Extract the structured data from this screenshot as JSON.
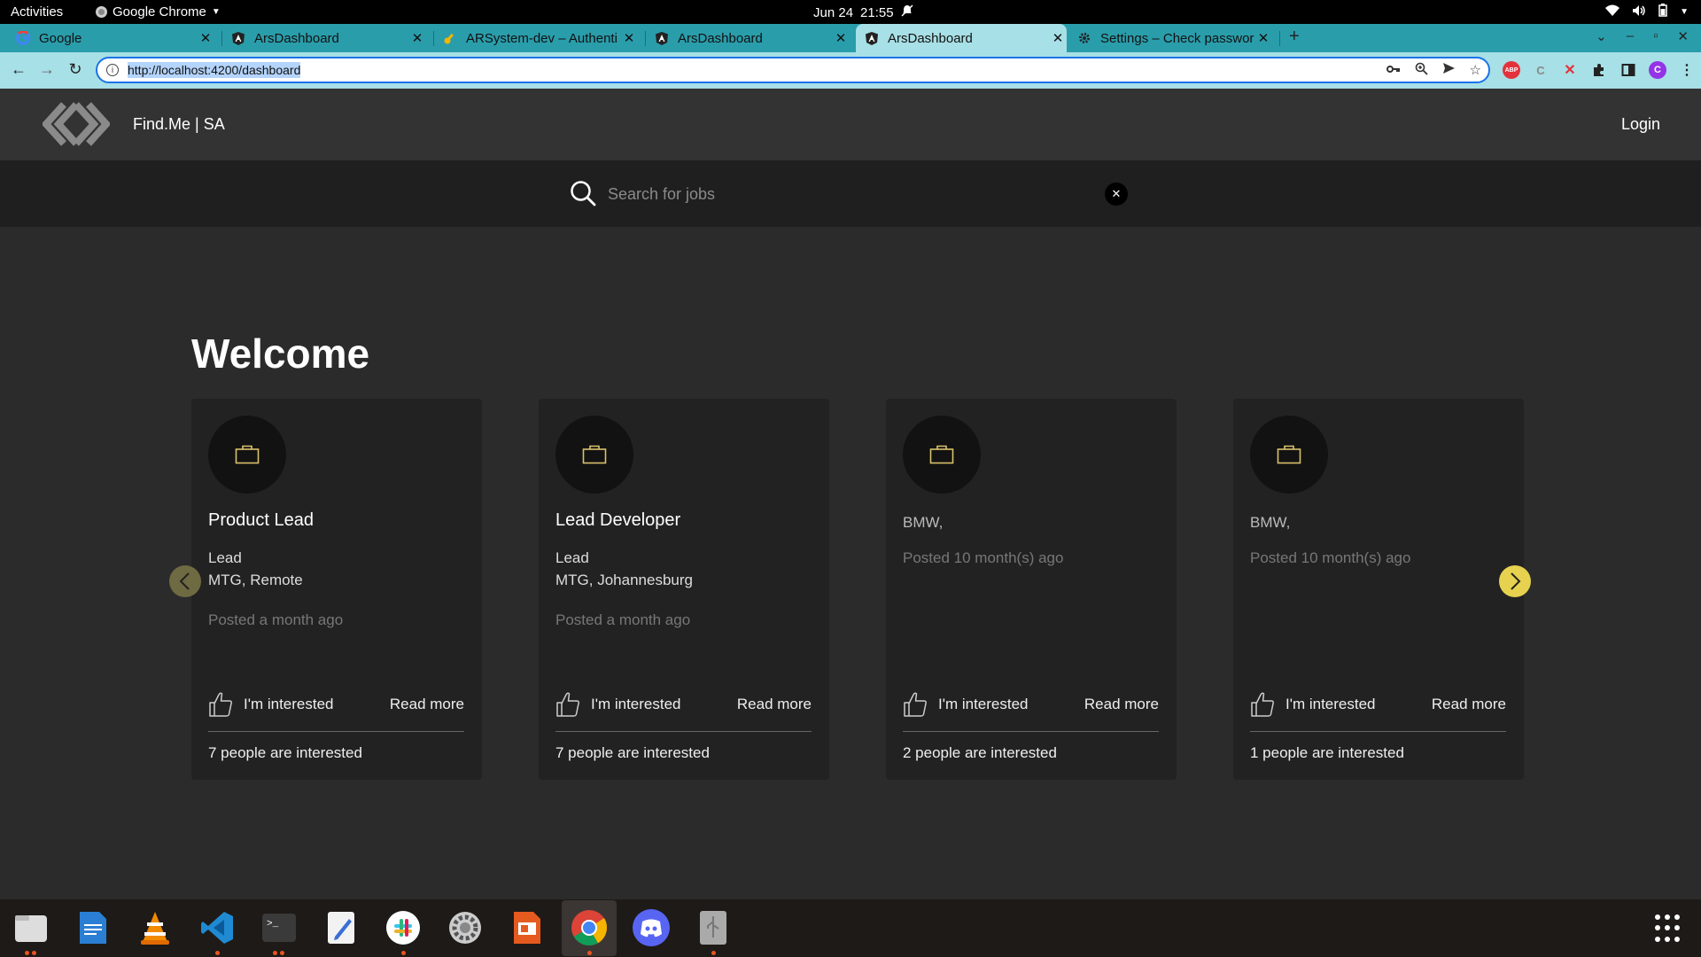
{
  "system": {
    "activities": "Activities",
    "app_name": "Google Chrome",
    "date": "Jun 24",
    "time": "21:55"
  },
  "browser": {
    "tabs": [
      {
        "title": "Google",
        "icon": "google-icon"
      },
      {
        "title": "ArsDashboard",
        "icon": "angular-icon"
      },
      {
        "title": "ARSystem-dev – Authenti",
        "icon": "key-icon"
      },
      {
        "title": "ArsDashboard",
        "icon": "angular-icon"
      },
      {
        "title": "ArsDashboard",
        "icon": "angular-icon",
        "active": true
      },
      {
        "title": "Settings – Check passwor",
        "icon": "gear-icon"
      }
    ],
    "url": "http://localhost:4200/dashboard",
    "profile_initial": "C",
    "ext_abp": "ABP"
  },
  "site": {
    "brand": "Find.Me | SA",
    "login": "Login",
    "search_placeholder": "Search for jobs",
    "welcome": "Welcome"
  },
  "jobs": [
    {
      "title": "Product Lead",
      "level": "Lead",
      "location": "MTG, Remote",
      "posted": "Posted a month ago",
      "interested_label": "I'm interested",
      "read_more": "Read more",
      "count_text": "7 people are interested"
    },
    {
      "title": "Lead Developer",
      "level": "Lead",
      "location": "MTG, Johannesburg",
      "posted": "Posted a month ago",
      "interested_label": "I'm interested",
      "read_more": "Read more",
      "count_text": "7 people are interested"
    },
    {
      "title": "BMW,",
      "posted": "Posted 10 month(s) ago",
      "interested_label": "I'm interested",
      "read_more": "Read more",
      "count_text": "2 people are interested"
    },
    {
      "title": "BMW,",
      "posted": "Posted 10 month(s) ago",
      "interested_label": "I'm interested",
      "read_more": "Read more",
      "count_text": "1 people are interested"
    }
  ],
  "colors": {
    "accent_yellow": "#e6d24e",
    "tab_strip": "#2a9dab",
    "toolbar": "#a7e0e6",
    "card_bg": "#222222"
  },
  "dock_apps": [
    "files-icon",
    "writer-icon",
    "vlc-icon",
    "vscode-icon",
    "terminal-icon",
    "text-editor-icon",
    "slack-icon",
    "settings-icon",
    "impress-icon",
    "chrome-icon",
    "discord-icon",
    "usb-icon"
  ]
}
